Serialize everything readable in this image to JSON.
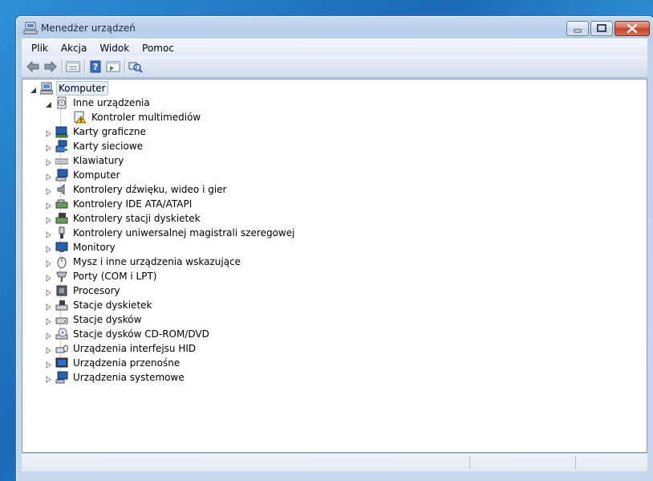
{
  "window": {
    "title": "Menedżer urządzeń",
    "title_icon": "device-manager-icon"
  },
  "menu": {
    "items": [
      "Plik",
      "Akcja",
      "Widok",
      "Pomoc"
    ]
  },
  "toolbar": {
    "buttons": [
      "back-arrow-icon",
      "forward-arrow-icon",
      "properties-view-icon",
      "help-icon",
      "action-pane-icon",
      "scan-hardware-icon"
    ]
  },
  "tree": {
    "root": {
      "label": "Komputer",
      "icon": "computer-icon",
      "expanded": true
    },
    "other_devices": {
      "label": "Inne urządzenia",
      "icon": "unknown-device-icon",
      "expanded": true
    },
    "multimedia_controller": {
      "label": "Kontroler multimediów",
      "icon": "warning-device-icon"
    },
    "categories": [
      {
        "label": "Karty graficzne",
        "icon": "display-adapter-icon"
      },
      {
        "label": "Karty sieciowe",
        "icon": "network-adapter-icon"
      },
      {
        "label": "Klawiatury",
        "icon": "keyboard-icon"
      },
      {
        "label": "Komputer",
        "icon": "computer-icon"
      },
      {
        "label": "Kontrolery dźwięku, wideo i gier",
        "icon": "speaker-icon"
      },
      {
        "label": "Kontrolery IDE ATA/ATAPI",
        "icon": "ide-controller-icon"
      },
      {
        "label": "Kontrolery stacji dyskietek",
        "icon": "floppy-controller-icon"
      },
      {
        "label": "Kontrolery uniwersalnej magistrali szeregowej",
        "icon": "usb-icon"
      },
      {
        "label": "Monitory",
        "icon": "monitor-icon"
      },
      {
        "label": "Mysz i inne urządzenia wskazujące",
        "icon": "mouse-icon"
      },
      {
        "label": "Porty (COM i LPT)",
        "icon": "port-icon"
      },
      {
        "label": "Procesory",
        "icon": "processor-icon"
      },
      {
        "label": "Stacje dyskietek",
        "icon": "floppy-drive-icon"
      },
      {
        "label": "Stacje dysków",
        "icon": "disk-drive-icon"
      },
      {
        "label": "Stacje dysków CD-ROM/DVD",
        "icon": "cdrom-icon"
      },
      {
        "label": "Urządzenia interfejsu HID",
        "icon": "hid-icon"
      },
      {
        "label": "Urządzenia przenośne",
        "icon": "portable-device-icon"
      },
      {
        "label": "Urządzenia systemowe",
        "icon": "system-device-icon"
      }
    ]
  },
  "colors": {
    "accent": "#1f5fa6",
    "selection_border": "#7ba0cc",
    "close_button": "#c4432a"
  }
}
